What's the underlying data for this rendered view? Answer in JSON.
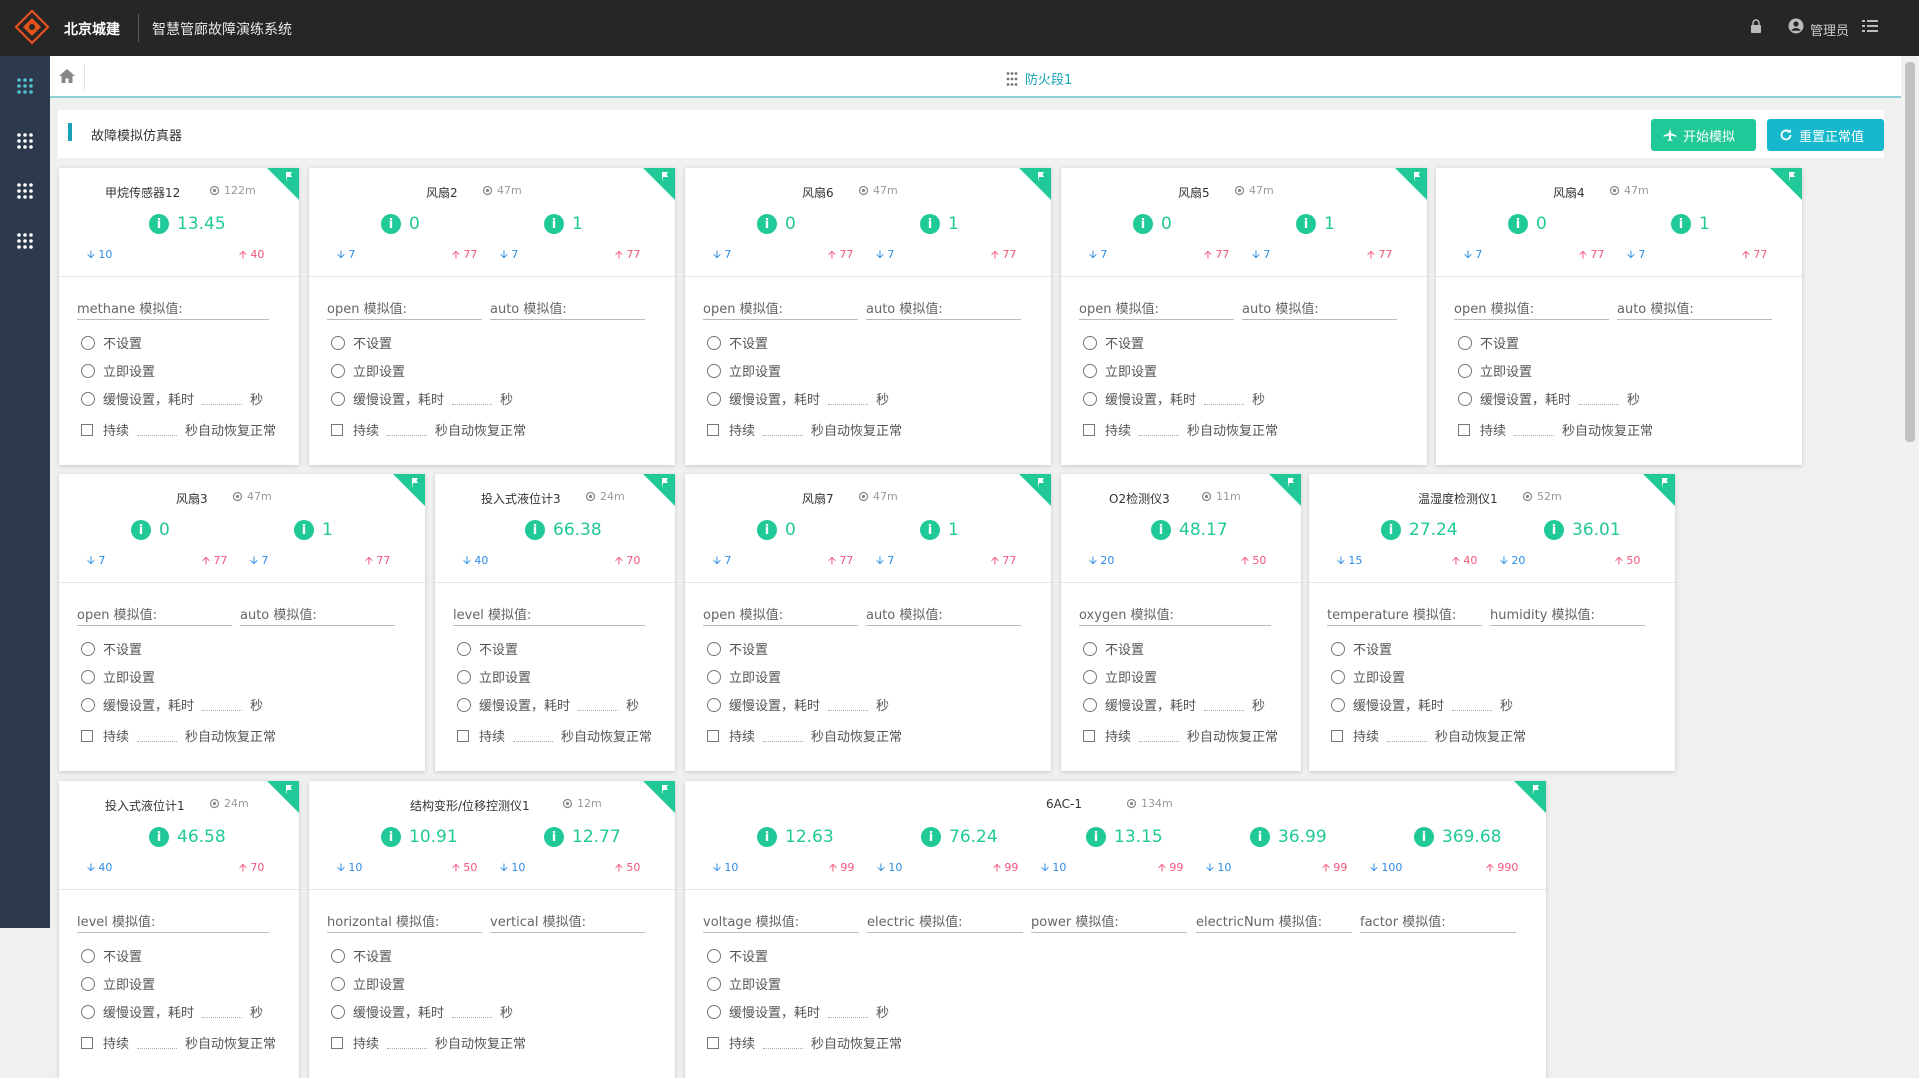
{
  "topbar": {
    "brand": "北京城建",
    "system_title": "智慧管廊故障演练系统",
    "user": "管理员"
  },
  "tab": {
    "name": "防火段1"
  },
  "header": {
    "title": "故障模拟仿真器",
    "start_label": "开始模拟",
    "reset_label": "重置正常值"
  },
  "options": {
    "none": "不设置",
    "immediate": "立即设置",
    "slow_prefix": "缓慢设置，耗时",
    "sec": "秒",
    "persist_prefix": "持续",
    "persist_suffix": "秒自动恢复正常"
  },
  "cards": [
    {
      "title": "甲烷传感器12",
      "distance": "122m",
      "readings": [
        {
          "value": "13.45",
          "low": "10",
          "high": "40",
          "field": "methane 模拟值:"
        }
      ]
    },
    {
      "title": "风扇2",
      "distance": "47m",
      "readings": [
        {
          "value": "0",
          "low": "7",
          "high": "77",
          "field": "open 模拟值:"
        },
        {
          "value": "1",
          "low": "7",
          "high": "77",
          "field": "auto 模拟值:"
        }
      ]
    },
    {
      "title": "风扇6",
      "distance": "47m",
      "readings": [
        {
          "value": "0",
          "low": "7",
          "high": "77",
          "field": "open 模拟值:"
        },
        {
          "value": "1",
          "low": "7",
          "high": "77",
          "field": "auto 模拟值:"
        }
      ]
    },
    {
      "title": "风扇5",
      "distance": "47m",
      "readings": [
        {
          "value": "0",
          "low": "7",
          "high": "77",
          "field": "open 模拟值:"
        },
        {
          "value": "1",
          "low": "7",
          "high": "77",
          "field": "auto 模拟值:"
        }
      ]
    },
    {
      "title": "风扇4",
      "distance": "47m",
      "readings": [
        {
          "value": "0",
          "low": "7",
          "high": "77",
          "field": "open 模拟值:"
        },
        {
          "value": "1",
          "low": "7",
          "high": "77",
          "field": "auto 模拟值:"
        }
      ]
    },
    {
      "title": "风扇3",
      "distance": "47m",
      "readings": [
        {
          "value": "0",
          "low": "7",
          "high": "77",
          "field": "open 模拟值:"
        },
        {
          "value": "1",
          "low": "7",
          "high": "77",
          "field": "auto 模拟值:"
        }
      ]
    },
    {
      "title": "投入式液位计3",
      "distance": "24m",
      "readings": [
        {
          "value": "66.38",
          "low": "40",
          "high": "70",
          "field": "level 模拟值:"
        }
      ]
    },
    {
      "title": "风扇7",
      "distance": "47m",
      "readings": [
        {
          "value": "0",
          "low": "7",
          "high": "77",
          "field": "open 模拟值:"
        },
        {
          "value": "1",
          "low": "7",
          "high": "77",
          "field": "auto 模拟值:"
        }
      ]
    },
    {
      "title": "O2检测仪3",
      "distance": "11m",
      "readings": [
        {
          "value": "48.17",
          "low": "20",
          "high": "50",
          "field": "oxygen 模拟值:"
        }
      ]
    },
    {
      "title": "温湿度检测仪1",
      "distance": "52m",
      "readings": [
        {
          "value": "27.24",
          "low": "15",
          "high": "40",
          "field": "temperature 模拟值:"
        },
        {
          "value": "36.01",
          "low": "20",
          "high": "50",
          "field": "humidity 模拟值:"
        }
      ]
    },
    {
      "title": "投入式液位计1",
      "distance": "24m",
      "readings": [
        {
          "value": "46.58",
          "low": "40",
          "high": "70",
          "field": "level 模拟值:"
        }
      ]
    },
    {
      "title": "结构变形/位移控测仪1",
      "distance": "12m",
      "readings": [
        {
          "value": "10.91",
          "low": "10",
          "high": "50",
          "field": "horizontal 模拟值:"
        },
        {
          "value": "12.77",
          "low": "10",
          "high": "50",
          "field": "vertical 模拟值:"
        }
      ]
    },
    {
      "title": "6AC-1",
      "distance": "134m",
      "readings": [
        {
          "value": "12.63",
          "low": "10",
          "high": "99",
          "field": "voltage 模拟值:"
        },
        {
          "value": "76.24",
          "low": "10",
          "high": "99",
          "field": "electric 模拟值:"
        },
        {
          "value": "13.15",
          "low": "10",
          "high": "99",
          "field": "power 模拟值:"
        },
        {
          "value": "36.99",
          "low": "10",
          "high": "99",
          "field": "electricNum 模拟值:"
        },
        {
          "value": "369.68",
          "low": "100",
          "high": "990",
          "field": "factor 模拟值:"
        }
      ]
    }
  ]
}
